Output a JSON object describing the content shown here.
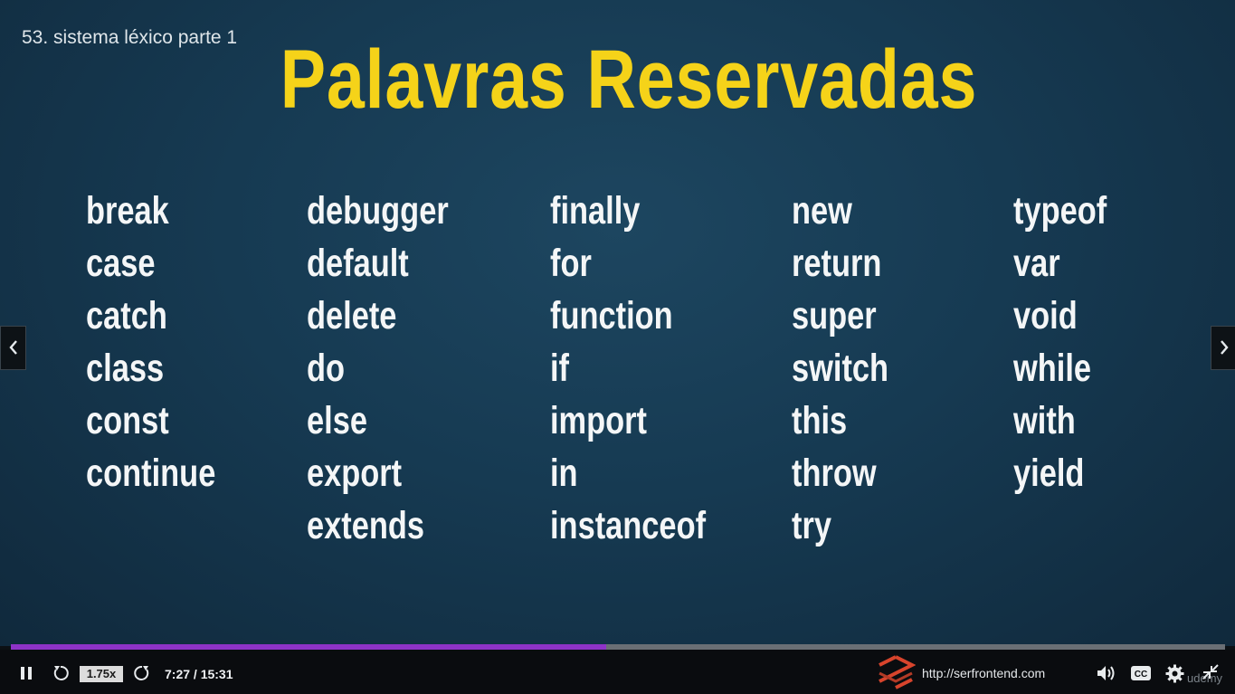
{
  "lecture": {
    "title": "53. sistema léxico parte 1"
  },
  "slide": {
    "title": "Palavras Reservadas",
    "columns": [
      [
        "break",
        "case",
        "catch",
        "class",
        "const",
        "continue"
      ],
      [
        "debugger",
        "default",
        "delete",
        "do",
        "else",
        "export",
        "extends"
      ],
      [
        "finally",
        "for",
        "function",
        "if",
        "import",
        "in",
        "instanceof"
      ],
      [
        "new",
        "return",
        "super",
        "switch",
        "this",
        "throw",
        "try"
      ],
      [
        "typeof",
        "var",
        "void",
        "while",
        "with",
        "yield"
      ]
    ]
  },
  "nav": {
    "prev_icon": "chevron-left-icon",
    "next_icon": "chevron-right-icon"
  },
  "player": {
    "progress_fraction": 0.49,
    "speed": "1.75x",
    "time": "7:27 / 15:31",
    "url": "http://serfrontend.com",
    "watermark": "udemy",
    "colors": {
      "title": "#f5d319",
      "progress": "#8e33c7",
      "logo": "#d8442c"
    }
  }
}
